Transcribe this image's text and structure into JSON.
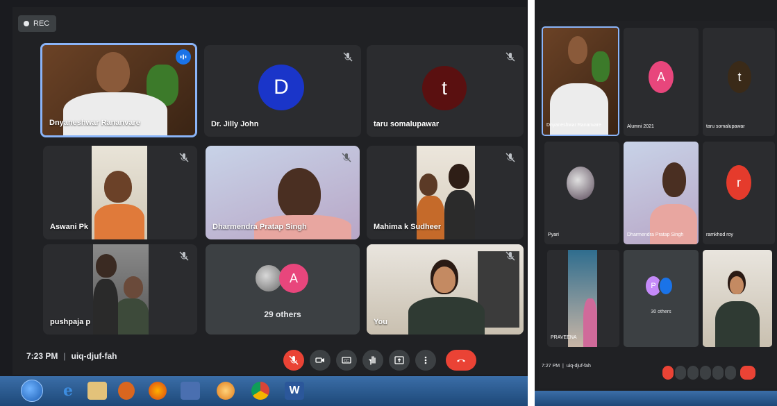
{
  "left_screen": {
    "rec_label": "REC",
    "participants": [
      {
        "name": "Dnyaneshwar Rananvare"
      },
      {
        "name": "Dr. Jilly John",
        "initial": "D"
      },
      {
        "name": "taru somalupawar",
        "initial": "t"
      },
      {
        "name": "Aswani Pk"
      },
      {
        "name": "Dharmendra Pratap Singh"
      },
      {
        "name": "Mahima k Sudheer"
      },
      {
        "name": "pushpaja p"
      },
      {
        "name": "29 others",
        "initial": "A"
      },
      {
        "name": "You"
      }
    ],
    "meeting": {
      "time": "7:23 PM",
      "separator": "|",
      "code": "uiq-djuf-fah"
    },
    "taskbar_word_label": "W"
  },
  "right_screen": {
    "participants": [
      {
        "name": "Dnyaneshwar Rananvare"
      },
      {
        "name": "Alumni 2021",
        "initial": "A"
      },
      {
        "name": "taru somalupawar",
        "initial": "t"
      },
      {
        "name": "Pyari"
      },
      {
        "name": "Dharmendra Pratap Singh"
      },
      {
        "name": "ramkhod roy",
        "initial": "r"
      },
      {
        "name": "PRAVEENA"
      },
      {
        "name": "30 others",
        "initial": "P"
      },
      {
        "name": ""
      }
    ],
    "meeting": {
      "time": "7:27 PM",
      "separator": "|",
      "code": "uiq-djuf-fah"
    }
  },
  "colors": {
    "meet_bg": "#202124",
    "tile_bg": "#3c4043",
    "active_border": "#8ab4f8",
    "avatar_blue": "#1a35c9",
    "avatar_maroon": "#5a1010",
    "avatar_pink": "#e8467c",
    "avatar_red": "#e53b2c",
    "avatar_purple": "#c58af9",
    "hangup_red": "#ea4335"
  },
  "icons": [
    "mic-off-icon",
    "camera-icon",
    "captions-icon",
    "raise-hand-icon",
    "present-icon",
    "more-options-icon",
    "hang-up-icon"
  ]
}
